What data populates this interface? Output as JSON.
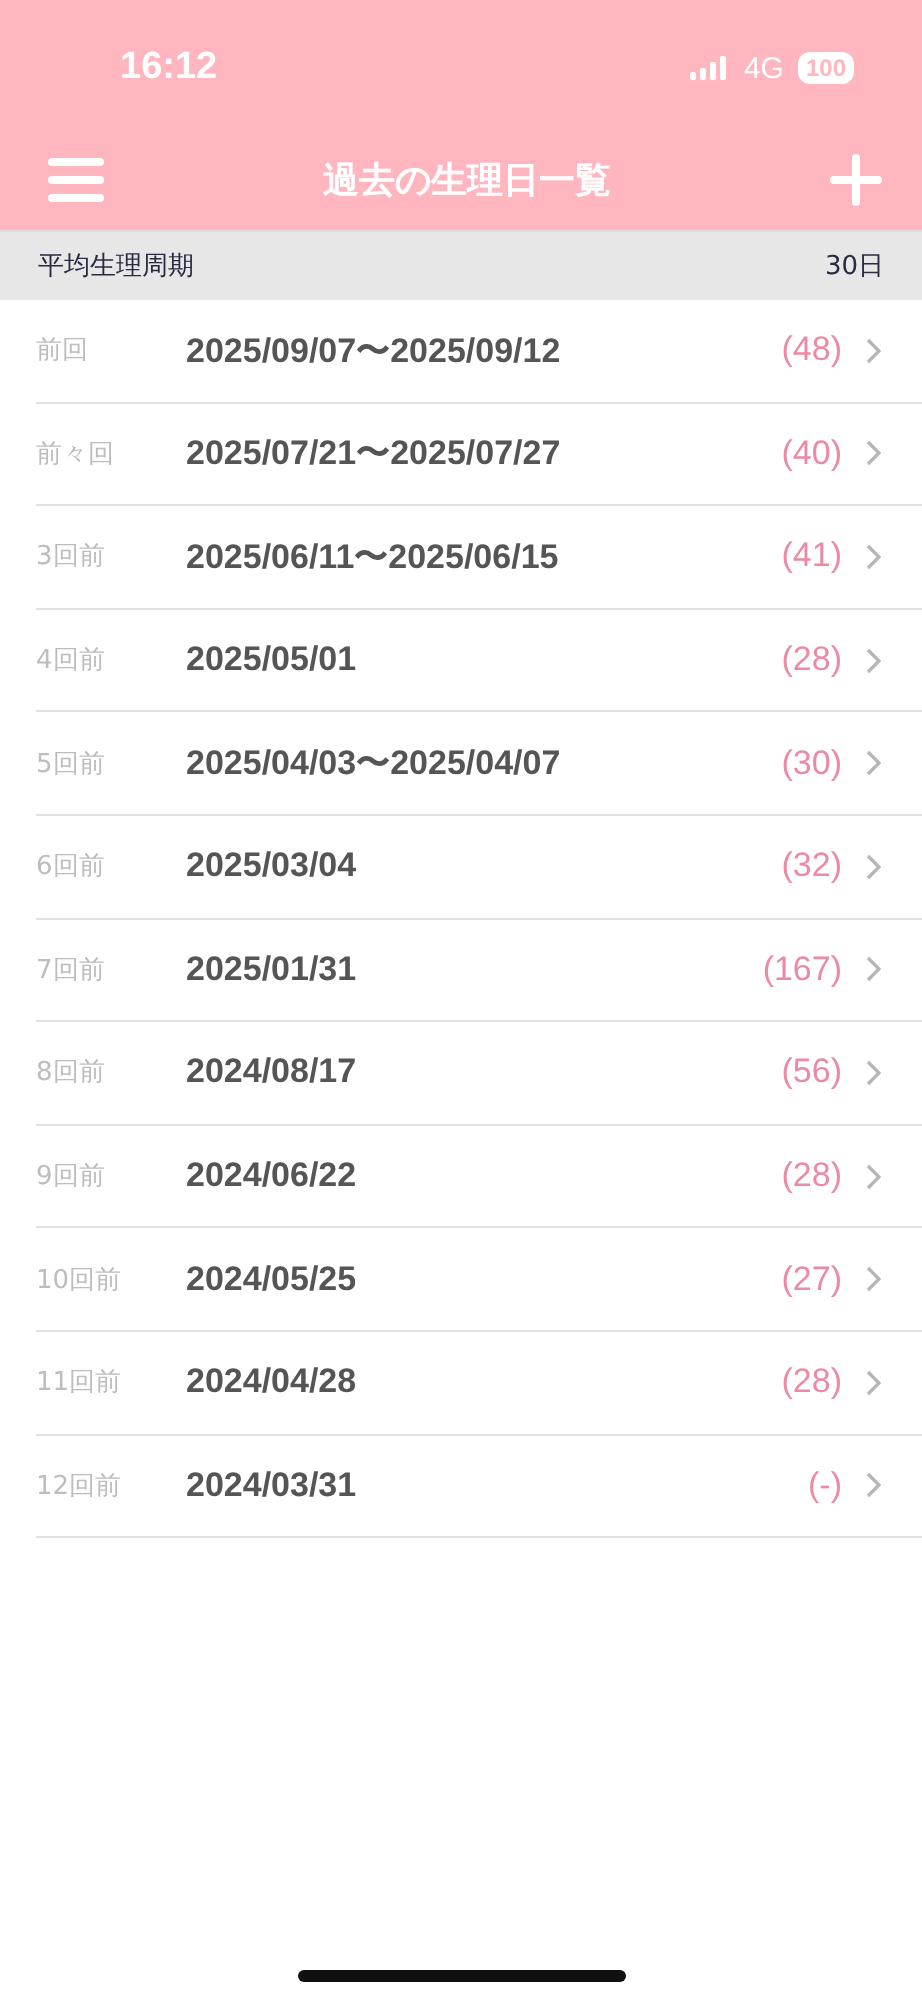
{
  "status_bar": {
    "time": "16:12",
    "network": "4G",
    "battery": "100"
  },
  "nav_bar": {
    "title": "過去の生理日一覧"
  },
  "summary": {
    "label": "平均生理周期",
    "value": "30日"
  },
  "rows": [
    {
      "label": "前回",
      "dates": "2025/09/07〜2025/09/12",
      "cycle": "(48)"
    },
    {
      "label": "前々回",
      "dates": "2025/07/21〜2025/07/27",
      "cycle": "(40)"
    },
    {
      "label": "3回前",
      "dates": "2025/06/11〜2025/06/15",
      "cycle": "(41)"
    },
    {
      "label": "4回前",
      "dates": "2025/05/01",
      "cycle": "(28)"
    },
    {
      "label": "5回前",
      "dates": "2025/04/03〜2025/04/07",
      "cycle": "(30)"
    },
    {
      "label": "6回前",
      "dates": "2025/03/04",
      "cycle": "(32)"
    },
    {
      "label": "7回前",
      "dates": "2025/01/31",
      "cycle": "(167)"
    },
    {
      "label": "8回前",
      "dates": "2024/08/17",
      "cycle": "(56)"
    },
    {
      "label": "9回前",
      "dates": "2024/06/22",
      "cycle": "(28)"
    },
    {
      "label": "10回前",
      "dates": "2024/05/25",
      "cycle": "(27)"
    },
    {
      "label": "11回前",
      "dates": "2024/04/28",
      "cycle": "(28)"
    },
    {
      "label": "12回前",
      "dates": "2024/03/31",
      "cycle": "(-)"
    }
  ]
}
